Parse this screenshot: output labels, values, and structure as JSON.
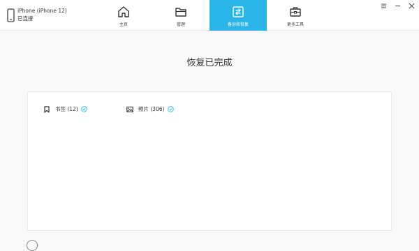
{
  "device": {
    "name": "iPhone (iPhone 12)",
    "status": "已连接"
  },
  "nav": {
    "home": "主页",
    "manage": "管理",
    "backup": "备份和恢复",
    "tools": "更多工具"
  },
  "colors": {
    "accent": "#29b5e8",
    "check": "#29b5e8"
  },
  "main": {
    "title": "恢复已完成",
    "items": [
      {
        "label": "书签 (12)",
        "icon": "bookmark-icon",
        "status": "completed"
      },
      {
        "label": "照片 (306)",
        "icon": "photo-icon",
        "status": "completed"
      }
    ]
  }
}
